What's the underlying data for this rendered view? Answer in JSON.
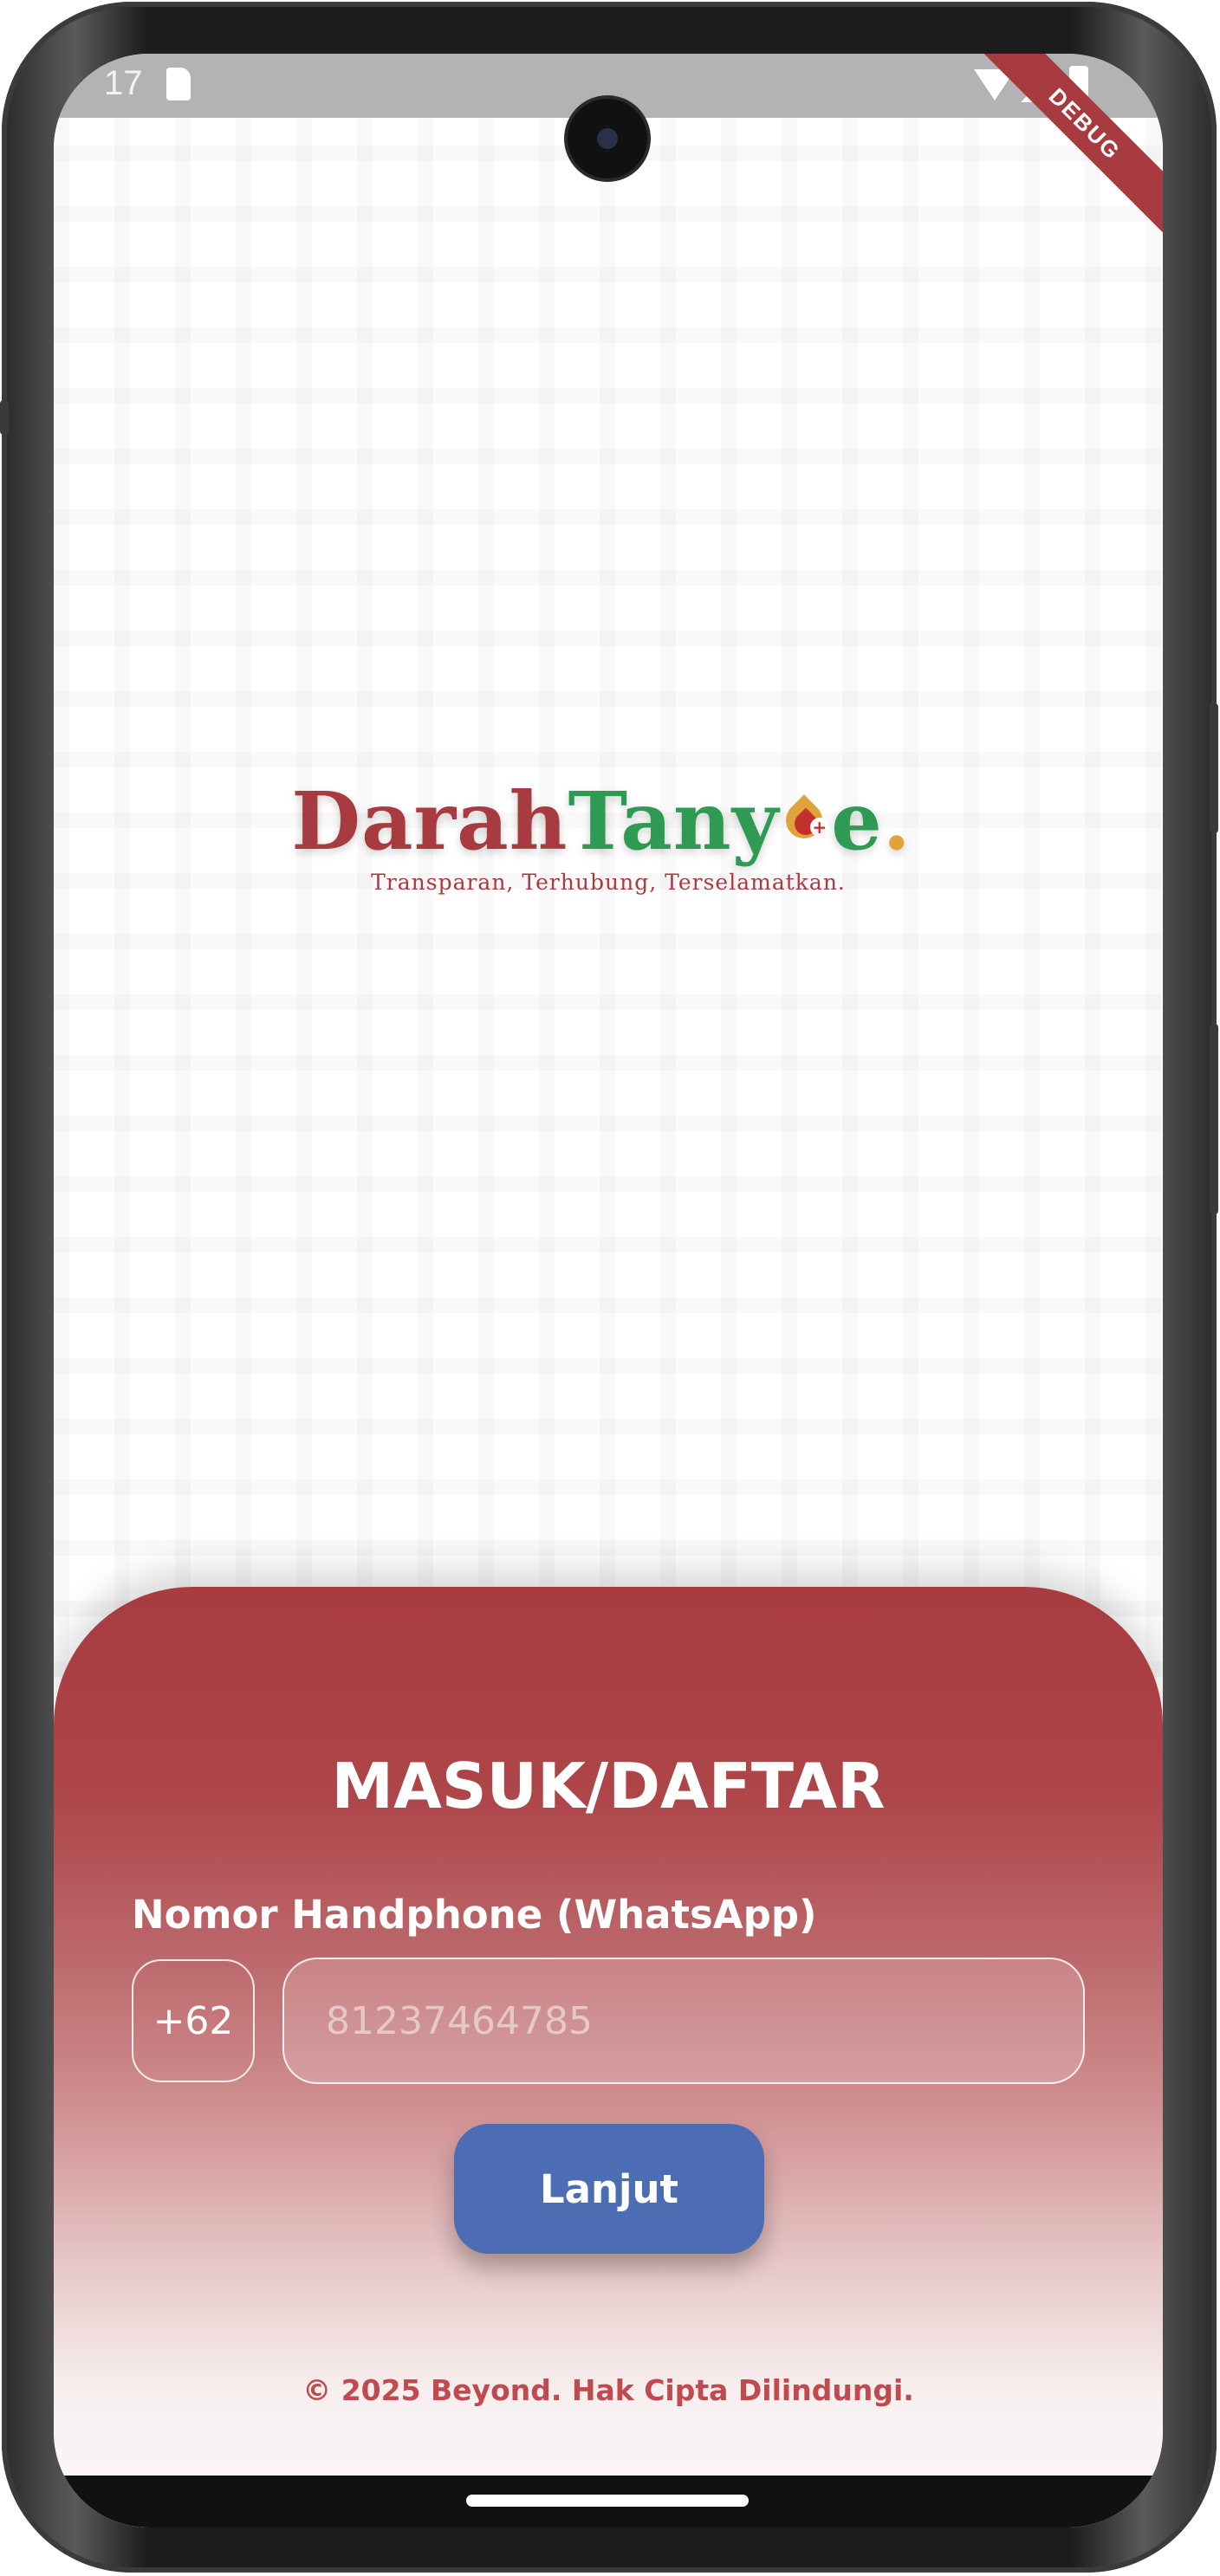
{
  "status_bar": {
    "time": "17",
    "debug_label": "DEBUG"
  },
  "logo": {
    "part1": "Darah",
    "part2": "Tany",
    "part3": "e",
    "dot": ".",
    "tagline": "Transparan, Terhubung, Terselamatkan."
  },
  "login": {
    "title": "MASUK/DAFTAR",
    "phone_label": "Nomor Handphone (WhatsApp)",
    "country_code": "+62",
    "phone_placeholder": "81237464785",
    "phone_value": "",
    "continue_label": "Lanjut",
    "copyright": "© 2025 Beyond. Hak Cipta Dilindungi."
  },
  "colors": {
    "brand_red": "#a83c40",
    "brand_green": "#2f9a53",
    "brand_gold": "#e0a23a",
    "button_blue": "#4c6db3"
  }
}
